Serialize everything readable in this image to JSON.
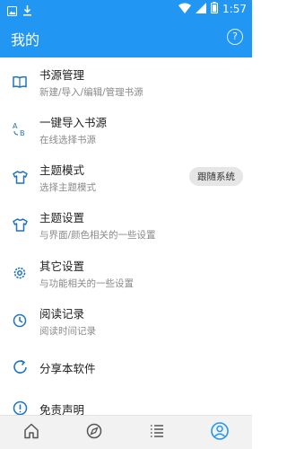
{
  "status_bar": {
    "time": "1:57",
    "icons": [
      "image-icon",
      "download-icon",
      "wifi-icon",
      "signal-icon",
      "battery-icon"
    ]
  },
  "app_bar": {
    "title": "我的",
    "help_label": "?",
    "color": "#2196F3"
  },
  "menu": {
    "items": [
      {
        "icon": "book-icon",
        "title": "书源管理",
        "subtitle": "新建/导入/编辑/管理书源"
      },
      {
        "icon": "translate-icon",
        "title": "一键导入书源",
        "subtitle": "在线选择书源"
      },
      {
        "icon": "shirt-icon",
        "title": "主题模式",
        "subtitle": "选择主题模式",
        "badge": "跟随系统"
      },
      {
        "icon": "shirt-icon",
        "title": "主题设置",
        "subtitle": "与界面/颜色相关的一些设置"
      },
      {
        "icon": "gear-icon",
        "title": "其它设置",
        "subtitle": "与功能相关的一些设置"
      },
      {
        "icon": "clock-icon",
        "title": "阅读记录",
        "subtitle": "阅读时间记录"
      },
      {
        "icon": "share-icon",
        "title": "分享本软件"
      },
      {
        "icon": "info-icon",
        "title": "免责声明"
      }
    ]
  },
  "bottom_nav": {
    "items": [
      {
        "name": "home-icon",
        "active": false
      },
      {
        "name": "explore-icon",
        "active": false
      },
      {
        "name": "list-icon",
        "active": false
      },
      {
        "name": "profile-icon",
        "active": true
      }
    ],
    "active_color": "#2196F3",
    "inactive_color": "#555555"
  }
}
